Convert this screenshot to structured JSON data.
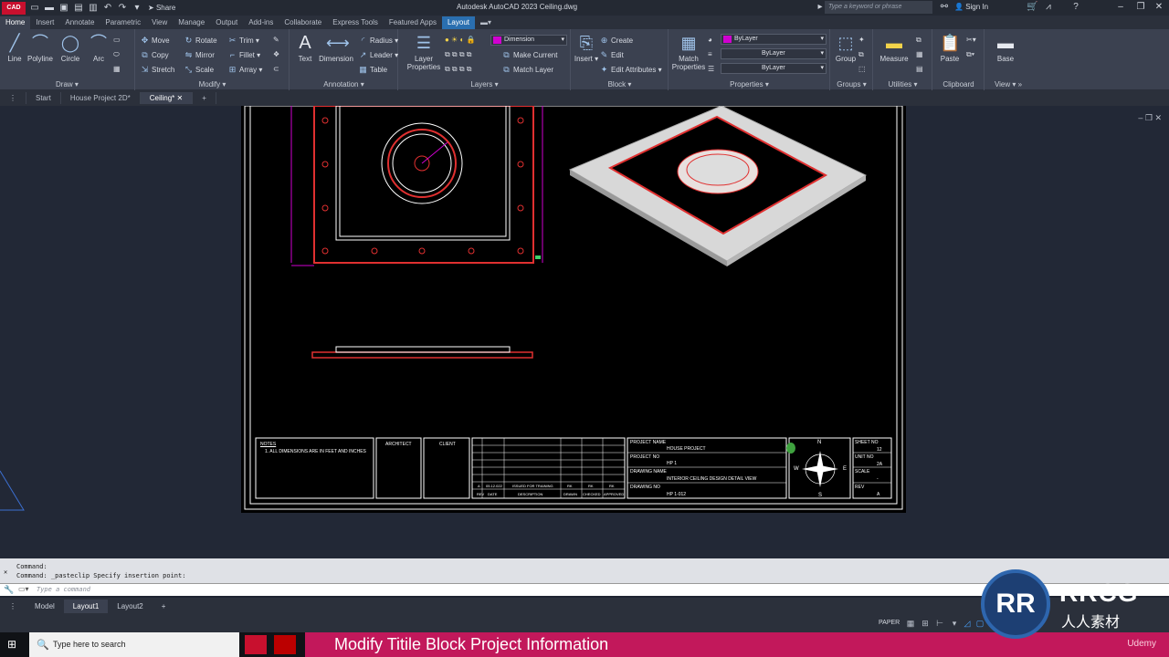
{
  "app": {
    "logo_text": "CAD",
    "window_title": "Autodesk AutoCAD 2023    Ceiling.dwg",
    "share_label": "Share",
    "search_placeholder": "Type a keyword or phrase",
    "signin_label": "Sign In"
  },
  "ribbon_tabs": [
    "Home",
    "Insert",
    "Annotate",
    "Parametric",
    "View",
    "Manage",
    "Output",
    "Add-ins",
    "Collaborate",
    "Express Tools",
    "Featured Apps",
    "Layout"
  ],
  "ribbon": {
    "draw": {
      "label": "Draw",
      "buttons": [
        "Line",
        "Polyline",
        "Circle",
        "Arc"
      ]
    },
    "modify": {
      "label": "Modify",
      "items": [
        "Move",
        "Rotate",
        "Trim",
        "Copy",
        "Mirror",
        "Fillet",
        "Stretch",
        "Scale",
        "Array"
      ]
    },
    "annotation": {
      "label": "Annotation",
      "buttons": [
        "Text",
        "Dimension"
      ],
      "items": [
        "Radius",
        "Leader",
        "Table"
      ]
    },
    "layers": {
      "label": "Layers",
      "button": "Layer Properties",
      "layer_name": "Dimension",
      "items": [
        "Make Current",
        "Match Layer"
      ]
    },
    "block": {
      "label": "Block",
      "button": "Insert",
      "items": [
        "Create",
        "Edit",
        "Edit Attributes"
      ]
    },
    "properties": {
      "label": "Properties",
      "button": "Match Properties",
      "values": [
        "ByLayer",
        "ByLayer",
        "ByLayer"
      ]
    },
    "groups": {
      "label": "Groups",
      "button": "Group"
    },
    "utilities": {
      "label": "Utilities",
      "button": "Measure"
    },
    "clipboard": {
      "label": "Clipboard",
      "button": "Paste"
    },
    "view": {
      "label": "View",
      "button": "Base"
    }
  },
  "doc_tabs": [
    "Start",
    "House Project 2D*",
    "Ceiling*"
  ],
  "drawing": {
    "notes_title": "NOTES",
    "notes_text": "1. ALL DIMENSIONS ARE IN FEET AND INCHES",
    "architect": "ARCHITECT",
    "client": "CLIENT",
    "rev_row": [
      "A",
      "05.12.022",
      "ISSUED FOR TRAINING",
      "RK",
      "RK",
      "RK"
    ],
    "rev_headers": [
      "REV",
      "DATE",
      "DESCRIPTION",
      "DRAWN",
      "CHECKED",
      "APPROVED"
    ],
    "project_name_label": "PROJECT NAME",
    "project_name": "HOUSE PROJECT",
    "project_no_label": "PROJECT NO",
    "project_no": "HP 1",
    "drawing_name_label": "DRAWING NAME",
    "drawing_name": "INTERIOR CEILING DESIGN DETAIL VIEW",
    "drawing_no_label": "DRAWING NO",
    "drawing_no": "HP 1-012",
    "compass": [
      "N",
      "S",
      "E",
      "W"
    ],
    "sheet_no_label": "SHEET NO",
    "sheet_no": "12",
    "unit_no_label": "UNIT NO",
    "unit_no": "2A",
    "scale_label": "SCALE",
    "scale": "-",
    "rev_label": "REV",
    "rev": "A"
  },
  "command": {
    "history": [
      "Command:",
      "Command: _pasteclip Specify insertion point:"
    ],
    "placeholder": "Type a command"
  },
  "layout_tabs": [
    "Model",
    "Layout1",
    "Layout2"
  ],
  "status": {
    "paper": "PAPER"
  },
  "taskbar": {
    "search": "Type here to search",
    "banner": "Modify Titile Block Project Information",
    "udemy": "Udemy"
  },
  "watermark": {
    "logo": "RR",
    "text": "RRCG",
    "sub": "人人素材"
  },
  "colors": {
    "accent": "#2a6fb0",
    "banner": "#c2185b",
    "magenta_layer": "#d000d0",
    "drawing_red": "#e03030"
  }
}
